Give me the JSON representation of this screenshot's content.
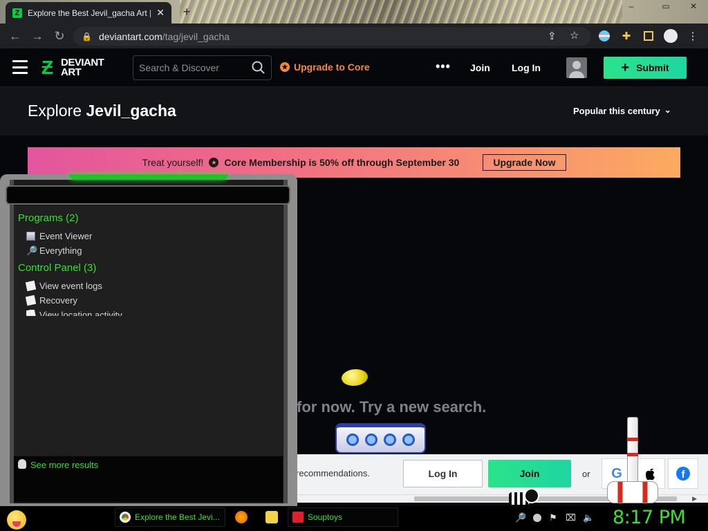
{
  "browser": {
    "tab_title": "Explore the Best Jevil_gacha Art |",
    "tab_close": "✕",
    "new_tab": "+",
    "window_controls": [
      "–",
      "▭",
      "✕"
    ],
    "url_host": "deviantart.com",
    "url_path": "/tag/jevil_gacha",
    "icons": [
      "back-icon",
      "forward-icon",
      "reload-icon",
      "lock-icon",
      "share-icon",
      "star-icon",
      "profile-icon",
      "extensions-icon",
      "sidepanel-icon",
      "account-icon",
      "menu-icon"
    ]
  },
  "header": {
    "logo_line1": "DEVIANT",
    "logo_line2": "ART",
    "search_placeholder": "Search & Discover",
    "upgrade_label": "Upgrade to Core",
    "more_label": "•••",
    "join_label": "Join",
    "login_label": "Log In",
    "submit_label": "Submit",
    "submit_icon": "+"
  },
  "explore": {
    "prefix": "Explore",
    "tag": "Jevil_gacha",
    "sort_label": "Popular this century",
    "sort_chevron": "⌄"
  },
  "promo": {
    "lead": "Treat yourself!",
    "offer": "Core Membership is 50% off through September 30",
    "button": "Upgrade Now"
  },
  "empty_state": {
    "message": "for now. Try a new search."
  },
  "recommend": {
    "text": "recommendations.",
    "login_label": "Log In",
    "join_label": "Join",
    "or_label": "or",
    "social": [
      "G",
      "",
      "f"
    ]
  },
  "start_search": {
    "categories": [
      {
        "label": "Programs (2)",
        "items": [
          "Event Viewer",
          "Everything"
        ]
      },
      {
        "label": "Control Panel (3)",
        "items": [
          "View event logs",
          "Recovery",
          "View location activity"
        ]
      }
    ],
    "see_more": "See more results"
  },
  "taskbar": {
    "tasks": [
      {
        "label": "Explore the Best Jevi...",
        "icon": "chrome-icon"
      },
      {
        "label": "Souptoys",
        "icon": "souptoys-icon"
      }
    ],
    "clock": "8:17 PM"
  },
  "colors": {
    "da_green": "#05cc47",
    "submit_gradient": [
      "#2be28a",
      "#1ed6a1"
    ],
    "promo_gradient": [
      "#e3559e",
      "#fcab60"
    ],
    "start_accent": "#38e02f",
    "core_orange": "#f58a3c"
  }
}
